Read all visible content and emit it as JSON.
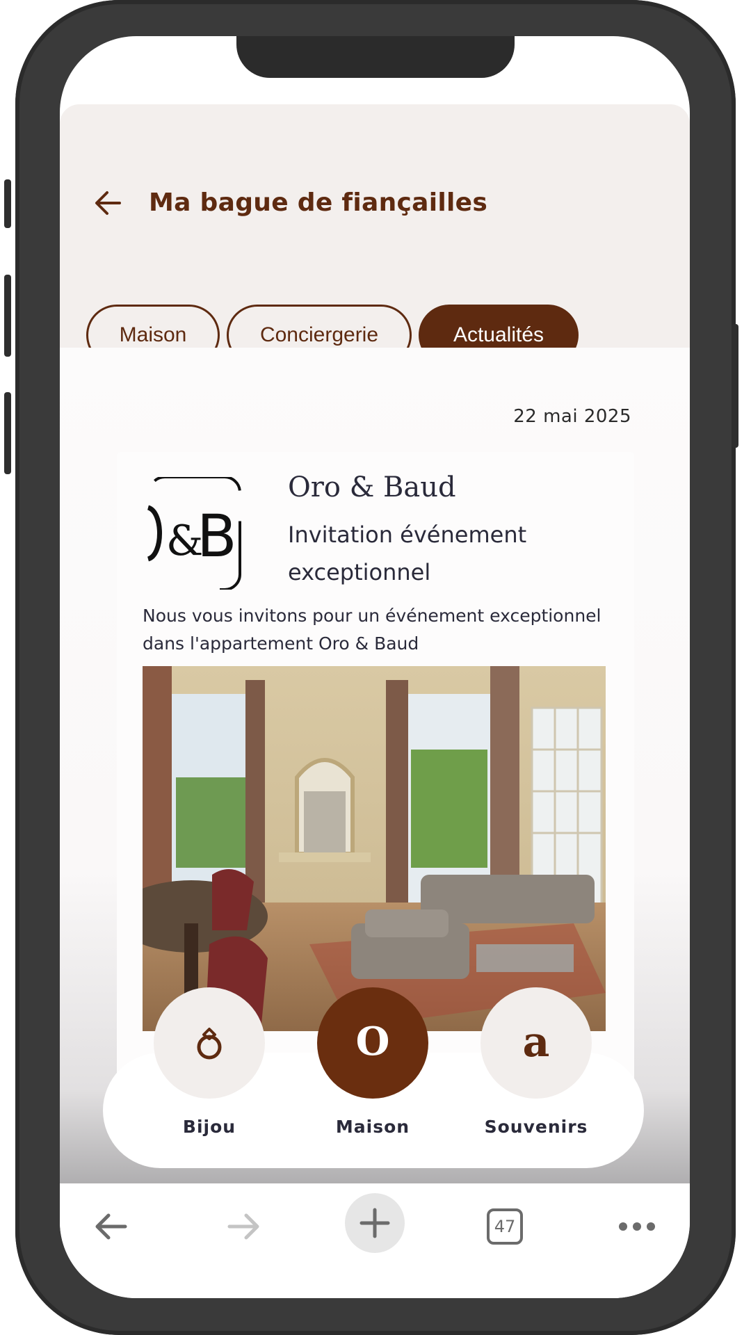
{
  "header": {
    "title": "Ma bague de fiançailles",
    "tabs": [
      {
        "label": "Maison",
        "active": false
      },
      {
        "label": "Conciergerie",
        "active": false
      },
      {
        "label": "Actualités",
        "active": true
      }
    ]
  },
  "post": {
    "date": "22 mai 2025",
    "brand": "Oro & Baud",
    "subtitle": "Invitation événement exceptionnel",
    "description": "Nous vous invitons pour un événement exceptionnel dans l'appartement Oro & Baud",
    "logo_text": "O&B"
  },
  "bottom_nav": {
    "items": [
      {
        "label": "Bijou",
        "icon": "ring-icon",
        "active": false
      },
      {
        "label": "Maison",
        "icon": "o-monogram-icon",
        "active": true
      },
      {
        "label": "Souvenirs",
        "icon": "a-monogram-icon",
        "active": false
      }
    ]
  },
  "browser": {
    "tab_count": "47"
  },
  "colors": {
    "brand_brown": "#5e2a10",
    "header_bg": "#f3efed",
    "text_dark": "#2a2a3a"
  }
}
